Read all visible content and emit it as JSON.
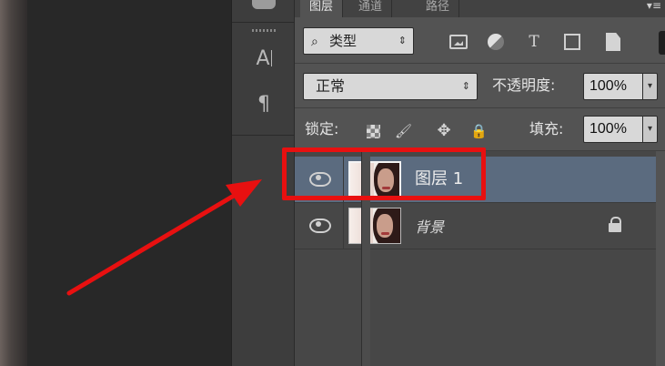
{
  "tabs": [
    "图层",
    "通道",
    "路径"
  ],
  "tabs_menu_glyph": "▾≡",
  "tools": {
    "type_tool": "A",
    "paragraph_tool": "¶"
  },
  "filter": {
    "search_glyph": "⌕",
    "label": "类型",
    "arrow": "⇕"
  },
  "filter_icons": [
    "image-filter-icon",
    "adjustment-filter-icon",
    "type-filter-icon",
    "shape-filter-icon",
    "smart-object-filter-icon"
  ],
  "filter_type_glyph": "T",
  "blend": {
    "mode": "正常",
    "arrow": "⇕"
  },
  "opacity": {
    "label": "不透明度:",
    "value": "100%"
  },
  "lock": {
    "label": "锁定:"
  },
  "fill": {
    "label": "填充:",
    "value": "100%"
  },
  "spin_arrow": "▾",
  "lock_glyphs": {
    "brush": "🖌",
    "move": "✥",
    "all": "🔒"
  },
  "layers": [
    {
      "name": "图层 1",
      "selected": true,
      "visible": true,
      "locked": false
    },
    {
      "name": "背景",
      "selected": false,
      "visible": true,
      "locked": true
    }
  ],
  "colors": {
    "selection": "#5b6b7f",
    "annotation": "#e81010",
    "panel": "#535353"
  }
}
